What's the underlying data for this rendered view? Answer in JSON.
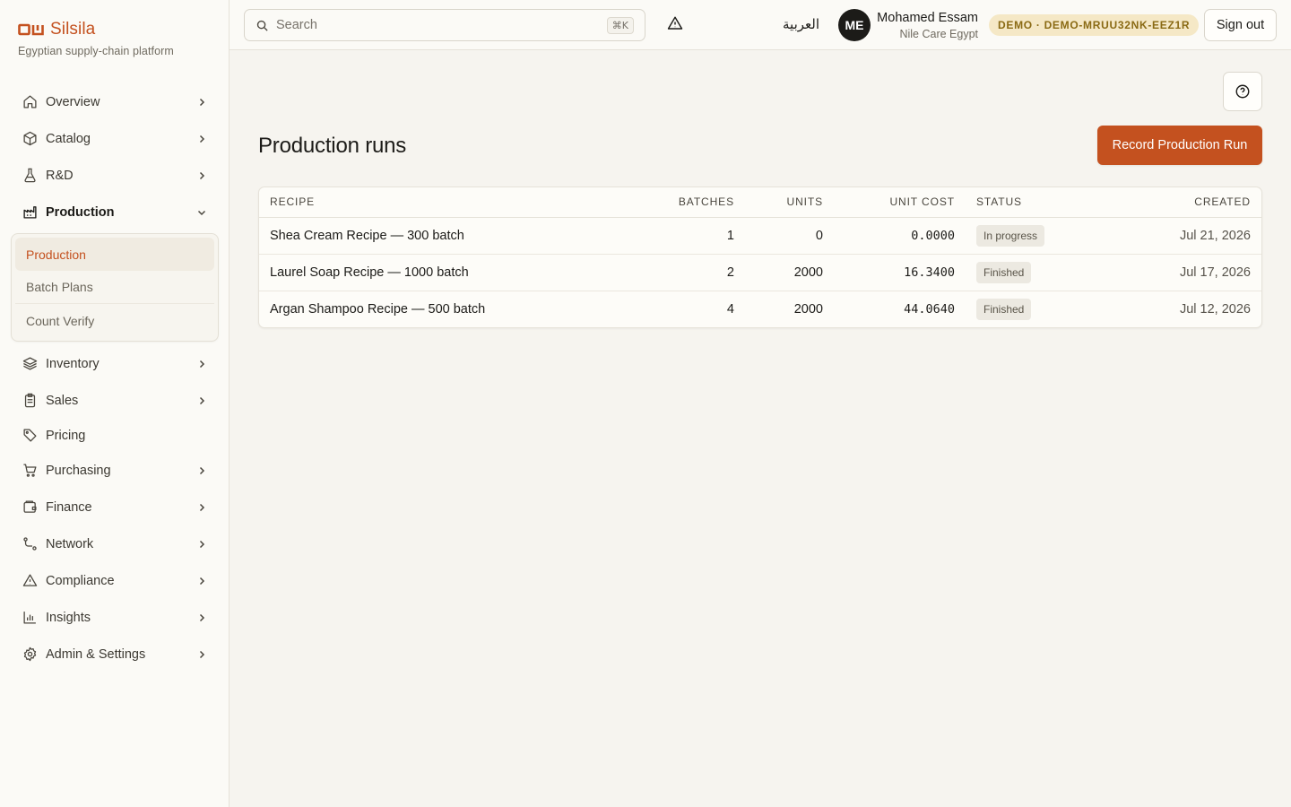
{
  "brand": {
    "name": "Silsila",
    "tagline": "Egyptian supply-chain platform",
    "color": "#c4511f"
  },
  "sidebar": {
    "items": [
      {
        "label": "Overview",
        "icon": "home-icon",
        "has_chevron": true
      },
      {
        "label": "Catalog",
        "icon": "box-icon",
        "has_chevron": true
      },
      {
        "label": "R&D",
        "icon": "flask-icon",
        "has_chevron": true
      },
      {
        "label": "Production",
        "icon": "factory-icon",
        "expanded": true
      },
      {
        "label": "Inventory",
        "icon": "layers-icon",
        "has_chevron": true
      },
      {
        "label": "Sales",
        "icon": "clipboard-icon",
        "has_chevron": true
      },
      {
        "label": "Pricing",
        "icon": "tag-icon",
        "has_chevron": false
      },
      {
        "label": "Purchasing",
        "icon": "cart-icon",
        "has_chevron": true
      },
      {
        "label": "Finance",
        "icon": "wallet-icon",
        "has_chevron": true
      },
      {
        "label": "Network",
        "icon": "route-icon",
        "has_chevron": true
      },
      {
        "label": "Compliance",
        "icon": "warning-triangle-icon",
        "has_chevron": true
      },
      {
        "label": "Insights",
        "icon": "bar-chart-icon",
        "has_chevron": true
      },
      {
        "label": "Admin & Settings",
        "icon": "gear-icon",
        "has_chevron": true
      }
    ],
    "production_sub": [
      {
        "label": "Production",
        "active": true
      },
      {
        "label": "Batch Plans"
      },
      {
        "label": "Count Verify"
      }
    ]
  },
  "topbar": {
    "search_placeholder": "Search",
    "search_shortcut": "⌘K",
    "language": "العربية",
    "avatar_initials": "ME",
    "user_name": "Mohamed Essam",
    "user_org": "Nile Care Egypt",
    "demo_badge": "DEMO · DEMO-MRUU32NK-EEZ1R",
    "sign_out": "Sign out"
  },
  "main": {
    "title": "Production runs",
    "primary_action": "Record Production Run",
    "table": {
      "headers": [
        "RECIPE",
        "BATCHES",
        "UNITS",
        "UNIT COST",
        "STATUS",
        "CREATED"
      ],
      "rows": [
        {
          "recipe": "Shea Cream Recipe — 300 batch",
          "batches": "1",
          "units": "0",
          "unit_cost": "0.0000",
          "status": "In progress",
          "created": "Jul 21, 2026"
        },
        {
          "recipe": "Laurel Soap Recipe — 1000 batch",
          "batches": "2",
          "units": "2000",
          "unit_cost": "16.3400",
          "status": "Finished",
          "created": "Jul 17, 2026"
        },
        {
          "recipe": "Argan Shampoo Recipe — 500 batch",
          "batches": "4",
          "units": "2000",
          "unit_cost": "44.0640",
          "status": "Finished",
          "created": "Jul 12, 2026"
        }
      ]
    }
  }
}
